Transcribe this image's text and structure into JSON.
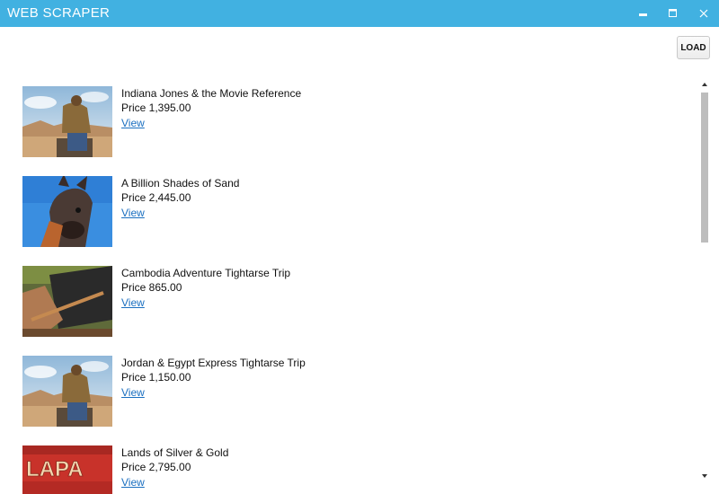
{
  "window": {
    "title": "WEB SCRAPER",
    "titlebar_color": "#41b1e1",
    "controls": [
      "minimize-icon",
      "maximize-icon",
      "close-icon"
    ]
  },
  "toolbar": {
    "load_label": "LOAD"
  },
  "items": [
    {
      "name": "Indiana Jones & the Movie Reference",
      "price": "Price 1,395.00",
      "link": "View",
      "thumb": "desert-man"
    },
    {
      "name": "A Billion Shades of Sand",
      "price": "Price 2,445.00",
      "link": "View",
      "thumb": "donkey"
    },
    {
      "name": "Cambodia Adventure Tightarse Trip",
      "price": "Price 865.00",
      "link": "View",
      "thumb": "rowing"
    },
    {
      "name": "Jordan & Egypt Express Tightarse Trip",
      "price": "Price 1,150.00",
      "link": "View",
      "thumb": "desert-man"
    },
    {
      "name": "Lands of Silver & Gold",
      "price": "Price 2,795.00",
      "link": "View",
      "thumb": "lapa-sign"
    }
  ],
  "thumb_texts": {
    "lapa": "LAPA"
  },
  "scrollbar": {
    "visible_fraction": 0.37,
    "position": 0.0
  },
  "link_color": "#1a6fc0"
}
